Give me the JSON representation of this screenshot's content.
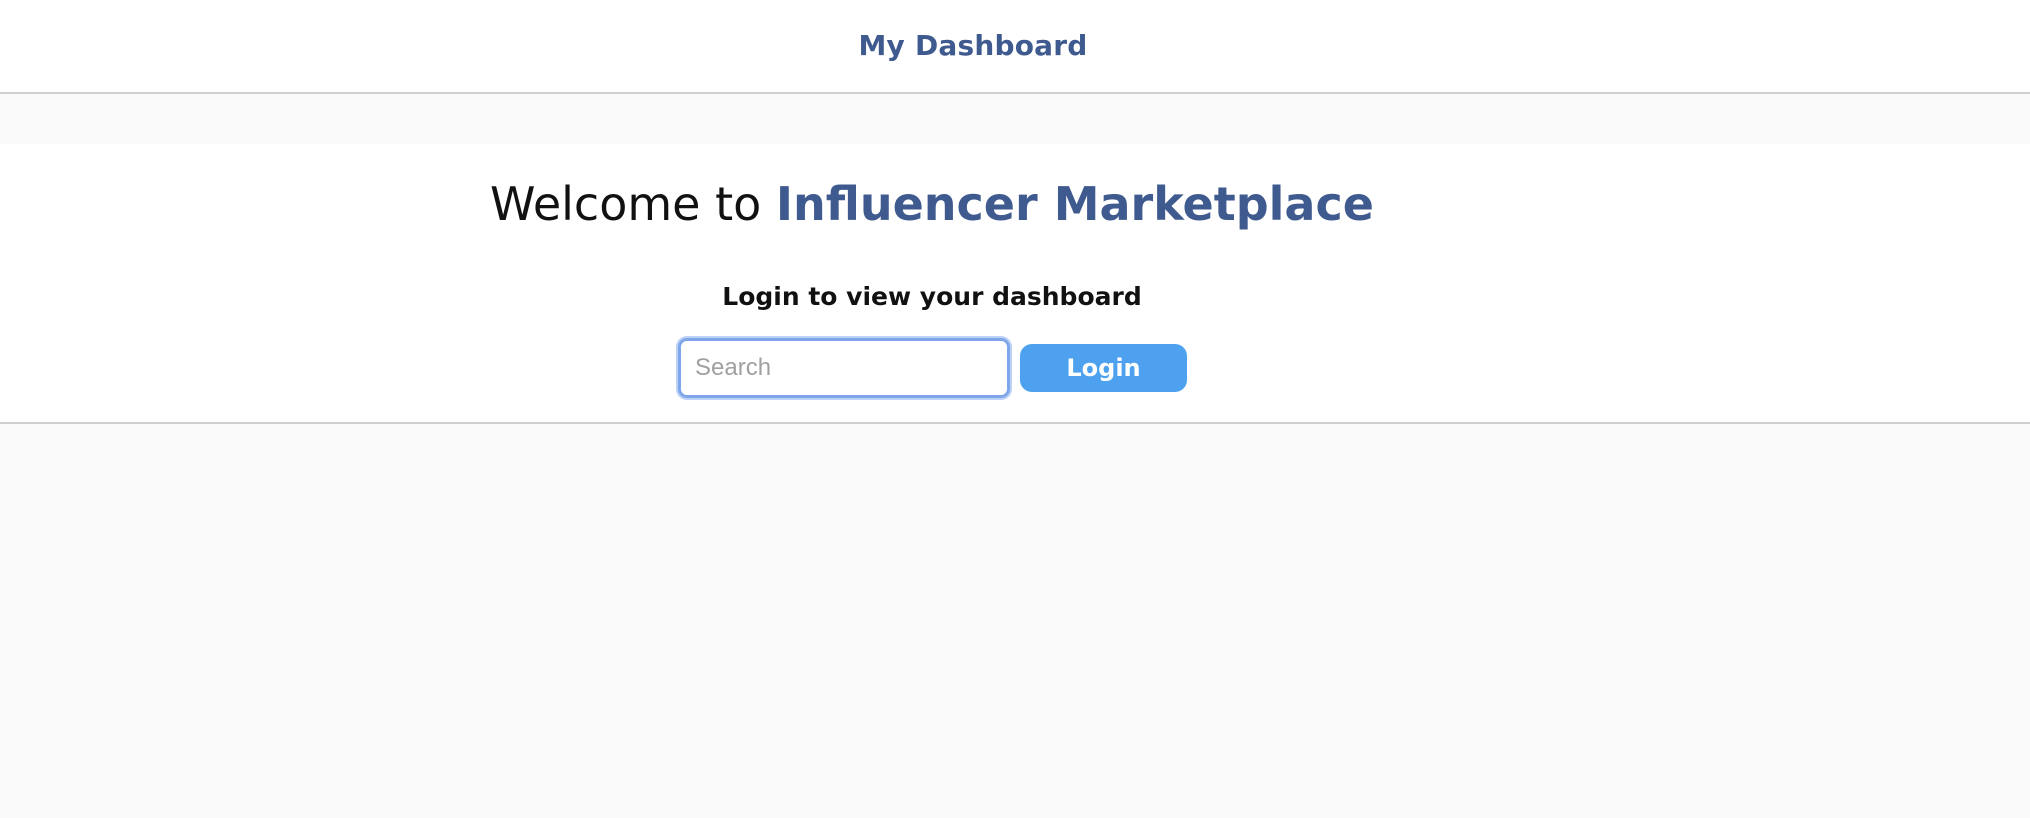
{
  "header": {
    "title": "My Dashboard"
  },
  "hero": {
    "heading_prefix": "Welcome to",
    "heading_brand": "Influencer Marketplace",
    "subheading": "Login to view your dashboard"
  },
  "login_form": {
    "input_placeholder": "Search",
    "input_value": "",
    "button_label": "Login"
  },
  "colors": {
    "brand": "#3f5a8f",
    "button": "#4da1ee",
    "page_background": "#f9f9f9",
    "input_focus_border": "#7fa6ea"
  }
}
